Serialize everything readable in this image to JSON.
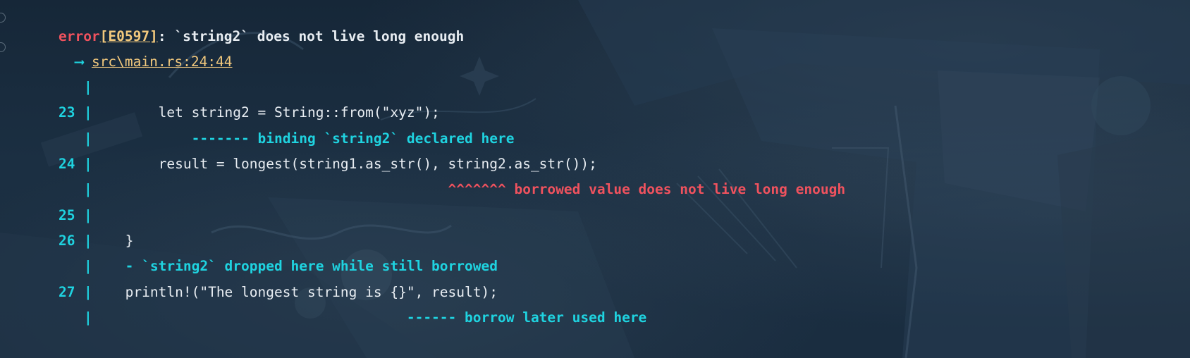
{
  "colors": {
    "error": "#f0525e",
    "link": "#f2c97d",
    "cyan": "#1fd3e0",
    "text": "#e8edf2",
    "background": "#17283a"
  },
  "error": {
    "label": "error",
    "code": "[E0597]",
    "message": ": `string2` does not live long enough"
  },
  "location": {
    "arrow": "-->",
    "path": "src\\main.rs:24:44"
  },
  "pipe": "|",
  "lines": [
    {
      "num": "23",
      "code": "        let string2 = String::from(\"xyz\");"
    },
    {
      "note": "            ------- binding `string2` declared here"
    },
    {
      "num": "24",
      "code": "        result = longest(string1.as_str(), string2.as_str());"
    },
    {
      "note": "                                           ^^^^^^^ borrowed value does not live long enough"
    },
    {
      "num": "25",
      "code": ""
    },
    {
      "num": "26",
      "code": "    }"
    },
    {
      "note": "    - `string2` dropped here while still borrowed"
    },
    {
      "num": "27",
      "code": "    println!(\"The longest string is {}\", result);"
    },
    {
      "note": "                                      ------ borrow later used here"
    }
  ]
}
